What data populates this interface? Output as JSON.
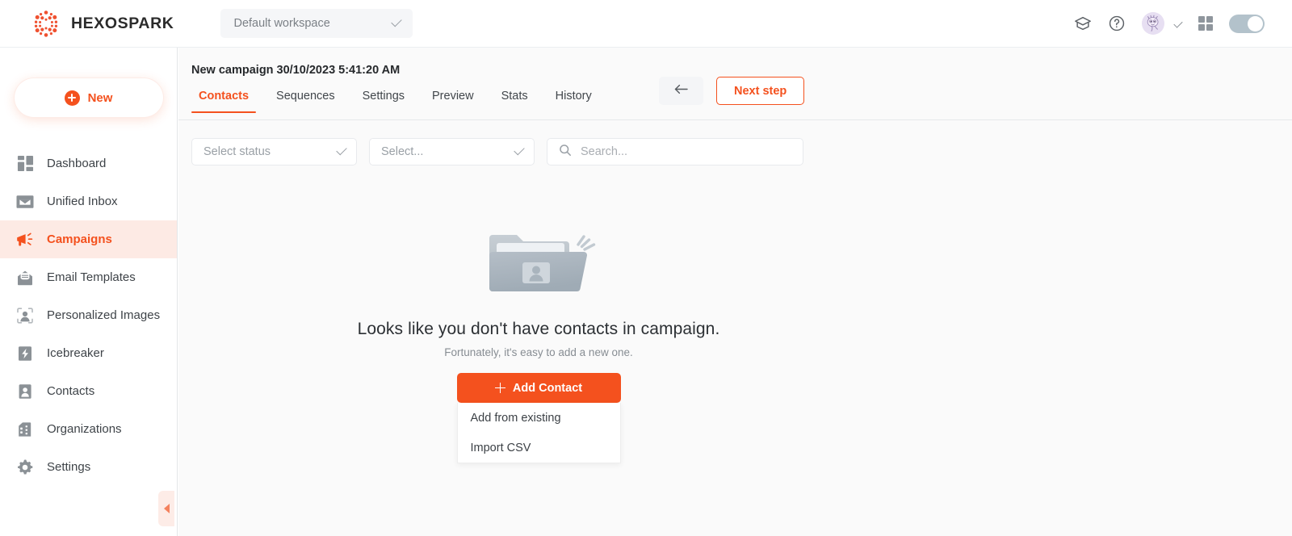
{
  "topbar": {
    "brand_name": "HEXOSPARK",
    "logo_icon": "hexospark-dots-logo",
    "workspace": {
      "value": "Default workspace",
      "caret_icon": "chevron-down-icon"
    },
    "icons": {
      "academy": "graduation-cap-icon",
      "help": "question-circle-icon",
      "avatar": "user-avatar",
      "avatar_caret": "chevron-down-icon",
      "apps": "grid-apps-icon",
      "mode_toggle": "toggle-switch-on"
    }
  },
  "sidebar": {
    "new_button": {
      "label": "New",
      "icon": "plus-circle-icon"
    },
    "items": [
      {
        "label": "Dashboard",
        "icon": "dashboard-icon",
        "active": false
      },
      {
        "label": "Unified Inbox",
        "icon": "inbox-icon",
        "active": false
      },
      {
        "label": "Campaigns",
        "icon": "megaphone-icon",
        "active": true
      },
      {
        "label": "Email Templates",
        "icon": "email-template-icon",
        "active": false
      },
      {
        "label": "Personalized Images",
        "icon": "personalized-image-icon",
        "active": false
      },
      {
        "label": "Icebreaker",
        "icon": "icebreaker-bolt-icon",
        "active": false
      },
      {
        "label": "Contacts",
        "icon": "contact-person-icon",
        "active": false
      },
      {
        "label": "Organizations",
        "icon": "organization-building-icon",
        "active": false
      },
      {
        "label": "Settings",
        "icon": "gear-icon",
        "active": false
      }
    ],
    "collapse_handle_icon": "chevron-left-icon"
  },
  "main": {
    "campaign_title": "New campaign 30/10/2023 5:41:20 AM",
    "tabs": [
      {
        "label": "Contacts",
        "active": true
      },
      {
        "label": "Sequences",
        "active": false
      },
      {
        "label": "Settings",
        "active": false
      },
      {
        "label": "Preview",
        "active": false
      },
      {
        "label": "Stats",
        "active": false
      },
      {
        "label": "History",
        "active": false
      }
    ],
    "back_button": {
      "icon": "arrow-left-icon"
    },
    "next_step_button": {
      "label": "Next step"
    },
    "filters": {
      "status_select": {
        "value": "Select status",
        "caret_icon": "chevron-down-icon"
      },
      "generic_select": {
        "value": "Select...",
        "caret_icon": "chevron-down-icon"
      },
      "search": {
        "placeholder": "Search...",
        "value": "",
        "icon": "search-icon"
      }
    },
    "empty_state": {
      "illustration_icon": "empty-contacts-folder-icon",
      "title": "Looks like you don't have contacts in campaign.",
      "subtitle": "Fortunately, it's easy to add a new one.",
      "add_button": {
        "label": "Add Contact",
        "icon": "plus-icon"
      },
      "menu_items": [
        {
          "label": "Add from existing"
        },
        {
          "label": "Import CSV"
        }
      ]
    }
  },
  "colors": {
    "accent": "#f4511e",
    "accent_soft": "#fdeae4",
    "text": "#3e4348",
    "muted": "#9aa0a6",
    "canvas": "#fafafa"
  }
}
